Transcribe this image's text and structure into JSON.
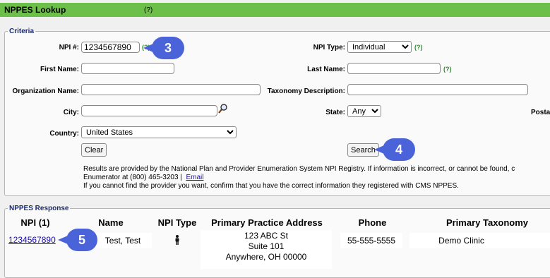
{
  "header": {
    "title": "NPPES Lookup",
    "help": "(?)"
  },
  "criteria": {
    "legend": "Criteria",
    "npi_label": "NPI #:",
    "npi_value": "1234567890",
    "npi_help": "(?)",
    "npi_type_label": "NPI Type:",
    "npi_type_value": "Individual",
    "npi_type_help": "(?)",
    "first_name_label": "First Name:",
    "last_name_label": "Last Name:",
    "last_name_help": "(?)",
    "org_name_label": "Organization Name:",
    "taxonomy_label": "Taxonomy Description:",
    "city_label": "City:",
    "state_label": "State:",
    "state_value": "Any",
    "postal_label": "Posta",
    "country_label": "Country:",
    "country_value": "United States",
    "clear_label": "Clear",
    "search_label": "Search",
    "info_line1": "Results are provided by the National Plan and Provider Enumeration System NPI Registry. If information is incorrect, or cannot be found, c",
    "info_line2": "Enumerator at (800) 465-3203 |",
    "info_email": "Email",
    "info_line3": "If you cannot find the provider you want, confirm that you have the correct information they registered with CMS NPPES."
  },
  "response": {
    "legend": "NPPES Response",
    "columns": [
      "NPI (1)",
      "Name",
      "NPI Type",
      "Primary Practice Address",
      "Phone",
      "Primary Taxonomy"
    ],
    "row": {
      "npi": "1234567890",
      "name": "Test, Test",
      "type_icon": "person-icon",
      "address1": "123 ABC St",
      "address2": "Suite 101",
      "address3": "Anywhere, OH 00000",
      "phone": "55-555-5555",
      "taxonomy": "Demo Clinic"
    }
  },
  "callouts": [
    "3",
    "4",
    "5"
  ],
  "colors": {
    "titlebar": "#6cc04a",
    "callout": "#4a63d8",
    "help": "#2e8b2e"
  }
}
